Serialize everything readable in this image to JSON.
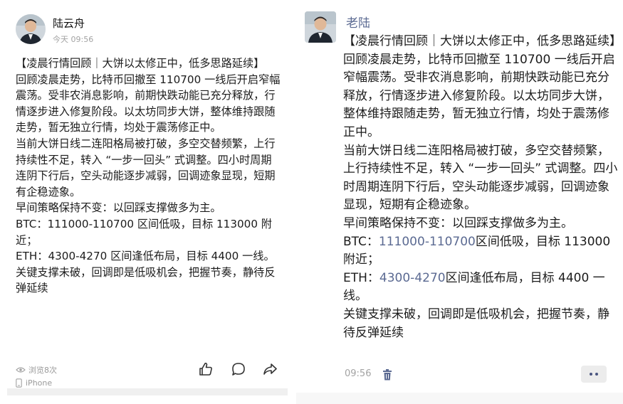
{
  "left": {
    "author": "陆云舟",
    "time": "今天 09:56",
    "body_lines": [
      "【凌晨行情回顾｜大饼以太修正中，低多思路延续】",
      "回顾凌晨走势，比特币回撤至 110700 一线后开启窄幅震荡。受非农消息影响，前期快跌动能已充分释放，行情逐步进入修复阶段。以太坊同步大饼，整体维持跟随走势，暂无独立行情，均处于震荡修正中。",
      "当前大饼日线二连阳格局被打破，多空交替频繁，上行持续性不足，转入 “一步一回头” 式调整。四小时周期连阴下行后，空头动能逐步减弱，回调迹象显现，短期有企稳迹象。",
      "早间策略保持不变：以回踩支撑做多为主。",
      "BTC：111000-110700 区间低吸，目标 113000 附近；",
      "ETH：4300-4270 区间逢低布局，目标 4400 一线。",
      "关键支撑未破，回调即是低吸机会，把握节奏，静待反弹延续"
    ],
    "views": "浏览8次",
    "device": "iPhone",
    "icons": {
      "eye": "eye-icon",
      "phone": "phone-icon",
      "like": "thumbs-up-icon",
      "comment": "comment-icon",
      "share": "share-icon"
    }
  },
  "right": {
    "author": "老陆",
    "title": "【凌晨行情回顾｜大饼以太修正中，低多思路延续】",
    "para1": "回顾凌晨走势，比特币回撤至 110700 一线后开启窄幅震荡。受非农消息影响，前期快跌动能已充分释放，行情逐步进入修复阶段。以太坊同步大饼，整体维持跟随走势，暂无独立行情，均处于震荡修正中。",
    "para2": "当前大饼日线二连阳格局被打破，多空交替频繁，上行持续性不足，转入 “一步一回头” 式调整。四小时周期连阴下行后，空头动能逐步减弱，回调迹象显现，短期有企稳迹象。",
    "para3": "早间策略保持不变：以回踩支撑做多为主。",
    "btc_prefix": "BTC：",
    "btc_range": "111000-110700",
    "btc_suffix": "区间低吸，目标 113000 附近；",
    "eth_prefix": "ETH：",
    "eth_range": "4300-4270",
    "eth_suffix": "区间逢低布局，目标 4400 一线。",
    "closing": "关键支撑未破，回调即是低吸机会，把握节奏，静待反弹延续",
    "time": "09:56",
    "icons": {
      "trash": "trash-icon",
      "more": "more-icon"
    }
  },
  "colors": {
    "link_blue": "#5b6a92",
    "meta_gray": "#a3a3a3",
    "text": "#1c1c1c"
  }
}
